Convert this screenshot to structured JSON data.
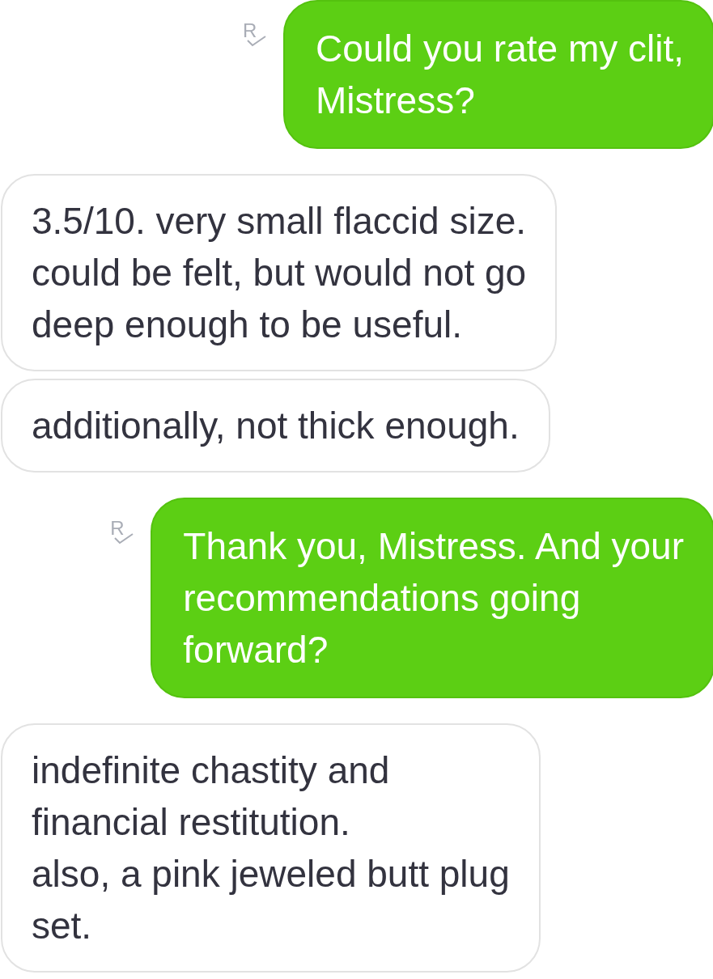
{
  "messages": [
    {
      "kind": "sent",
      "read_mark": "R",
      "text": "Could you rate my clit,\nMistress?"
    },
    {
      "kind": "received",
      "text": "3.5/10. very small flaccid size.\ncould be felt, but would not go\ndeep enough to be useful."
    },
    {
      "kind": "received",
      "text": "additionally, not thick enough."
    },
    {
      "kind": "sent",
      "read_mark": "R",
      "text": "Thank you, Mistress. And your\nrecommendations going\nforward?"
    },
    {
      "kind": "received",
      "text": "indefinite chastity and\nfinancial restitution.\nalso, a pink jeweled butt plug\nset."
    }
  ]
}
